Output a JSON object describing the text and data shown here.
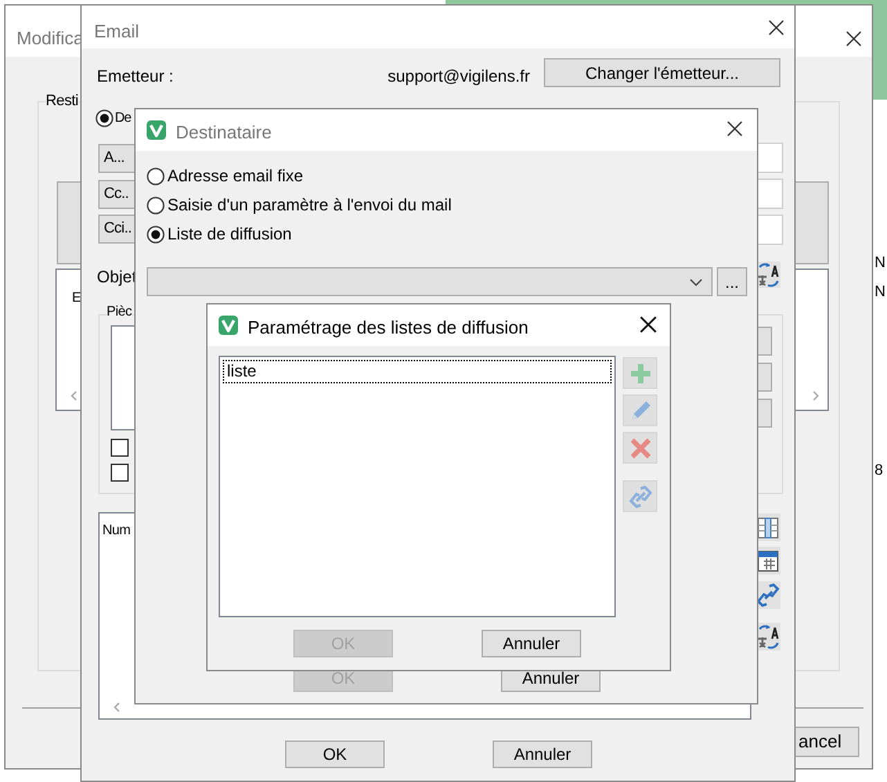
{
  "desktop": {
    "edge_texts": [
      "N",
      "N",
      "8"
    ]
  },
  "background_window": {
    "title": "Modifica",
    "group_label": "Resti",
    "panel_texts": [
      "E"
    ],
    "cancel_button": "ancel"
  },
  "email_dialog": {
    "title": "Email",
    "sender_label": "Emetteur :",
    "sender": "support@vigilens.fr",
    "change_sender_button": "Changer l'émetteur...",
    "mode_radio": {
      "label": "De",
      "selected": true
    },
    "recipient_buttons": [
      "A...",
      "Cc..",
      "Cci.."
    ],
    "subject_label": "Objet",
    "attachments_label": "Pièc",
    "checkboxes": [
      {
        "checked": false
      },
      {
        "checked": false
      }
    ],
    "list_header": "Num",
    "buttons": [
      "OK",
      "Annuler"
    ]
  },
  "recipient_dialog": {
    "title": "Destinataire",
    "options": [
      {
        "label": "Adresse email fixe",
        "selected": false
      },
      {
        "label": "Saisie d'un paramètre à l'envoi du mail",
        "selected": false
      },
      {
        "label": "Liste de diffusion",
        "selected": true
      }
    ],
    "more_button": "...",
    "buttons": [
      {
        "label": "OK",
        "disabled": true
      },
      {
        "label": "Annuler",
        "disabled": false
      }
    ]
  },
  "list_dialog": {
    "title": "Paramétrage des listes de diffusion",
    "items": [
      {
        "label": "liste",
        "selected": true
      }
    ],
    "tools": [
      {
        "kind": "add",
        "disabled": true
      },
      {
        "kind": "edit",
        "disabled": true
      },
      {
        "kind": "delete",
        "disabled": true
      },
      {
        "kind": "link",
        "disabled": true
      }
    ],
    "buttons": [
      {
        "label": "OK",
        "disabled": true
      },
      {
        "label": "Annuler",
        "disabled": false
      }
    ]
  }
}
